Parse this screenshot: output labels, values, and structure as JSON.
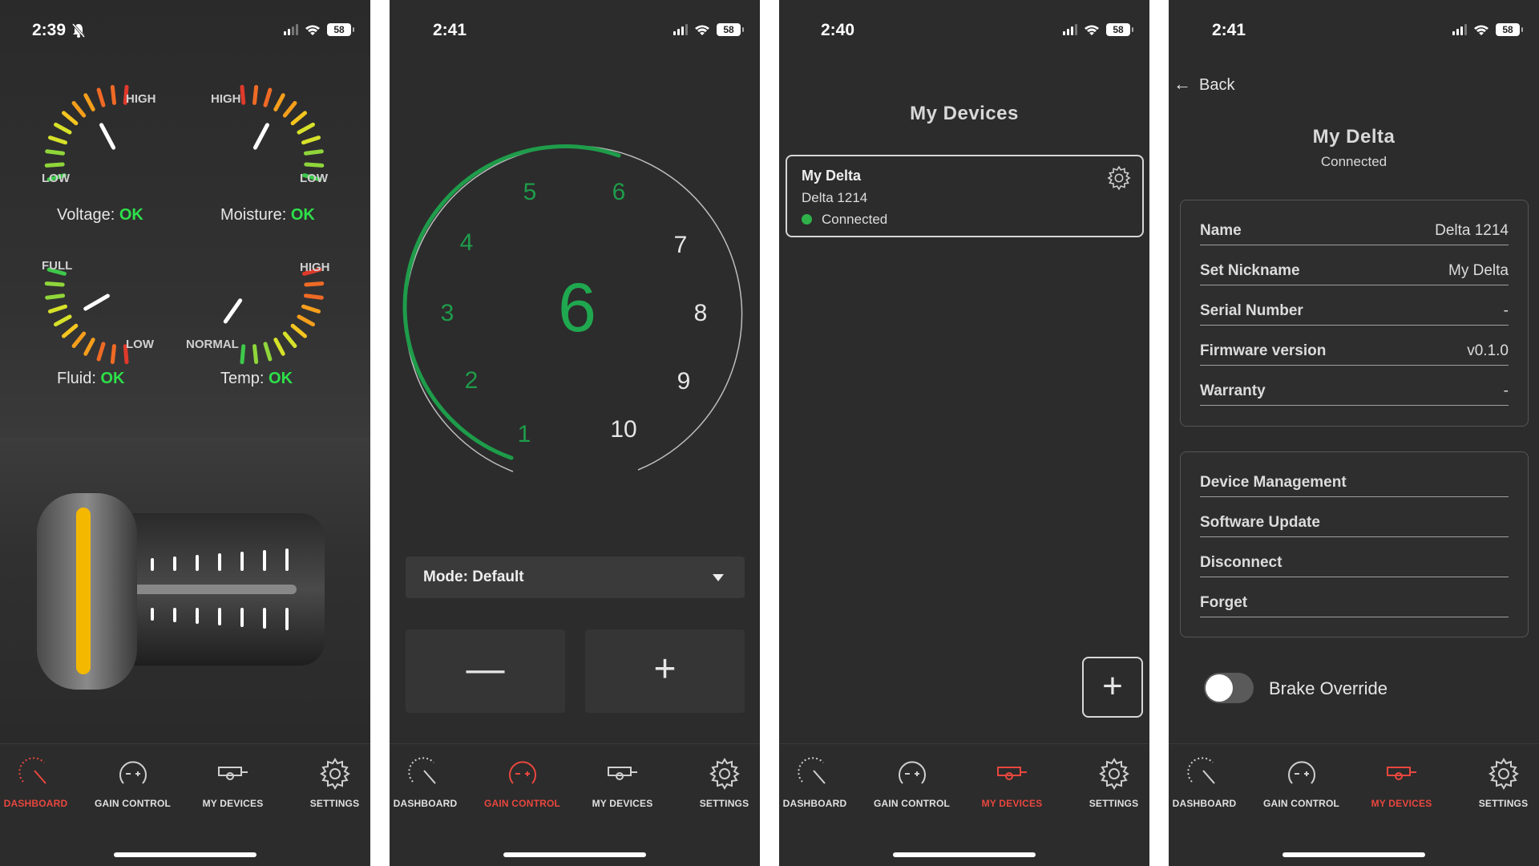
{
  "colors": {
    "accent_active": "#e8473e",
    "ok_green": "#2ee04a",
    "dial_green": "#1fa84f",
    "background": "#2c2c2c"
  },
  "status_bars": [
    {
      "time": "2:39",
      "battery": "58",
      "bell_muted": true
    },
    {
      "time": "2:41",
      "battery": "58"
    },
    {
      "time": "2:40",
      "battery": "58"
    },
    {
      "time": "2:41",
      "battery": "58"
    }
  ],
  "tabs": [
    {
      "label": "DASHBOARD",
      "icon": "speedometer-icon"
    },
    {
      "label": "GAIN CONTROL",
      "icon": "plus-minus-dial-icon"
    },
    {
      "label": "MY DEVICES",
      "icon": "trailer-icon"
    },
    {
      "label": "SETTINGS",
      "icon": "gear-icon"
    }
  ],
  "active_tabs": [
    "DASHBOARD",
    "GAIN CONTROL",
    "MY DEVICES",
    "MY DEVICES"
  ],
  "dashboard": {
    "voltage": {
      "high": "HIGH",
      "low": "LOW",
      "label": "Voltage:",
      "status": "OK"
    },
    "moisture": {
      "high": "HIGH",
      "low": "LOW",
      "label": "Moisture:",
      "status": "OK"
    },
    "fluid": {
      "full": "FULL",
      "low": "LOW",
      "label": "Fluid:",
      "status": "OK"
    },
    "temp": {
      "high": "HIGH",
      "normal": "NORMAL",
      "label": "Temp:",
      "status": "OK"
    }
  },
  "gain_control": {
    "value": "6",
    "scale": [
      "1",
      "2",
      "3",
      "4",
      "5",
      "6",
      "7",
      "8",
      "9",
      "10"
    ],
    "mode_label": "Mode: Default",
    "minus_glyph": "—",
    "plus_glyph": "+"
  },
  "my_devices": {
    "title": "My Devices",
    "devices": [
      {
        "name": "My Delta",
        "model": "Delta 1214",
        "status": "Connected"
      }
    ],
    "add_glyph": "+"
  },
  "device_detail": {
    "back_label": "Back",
    "title": "My Delta",
    "subtitle": "Connected",
    "info": [
      {
        "key": "Name",
        "value": "Delta 1214"
      },
      {
        "key": "Set Nickname",
        "value": "My Delta"
      },
      {
        "key": "Serial Number",
        "value": "-"
      },
      {
        "key": "Firmware version",
        "value": "v0.1.0"
      },
      {
        "key": "Warranty",
        "value": "-"
      }
    ],
    "actions": [
      "Device Management",
      "Software Update",
      "Disconnect",
      "Forget"
    ],
    "toggle_label": "Brake Override",
    "toggle_on": false
  }
}
